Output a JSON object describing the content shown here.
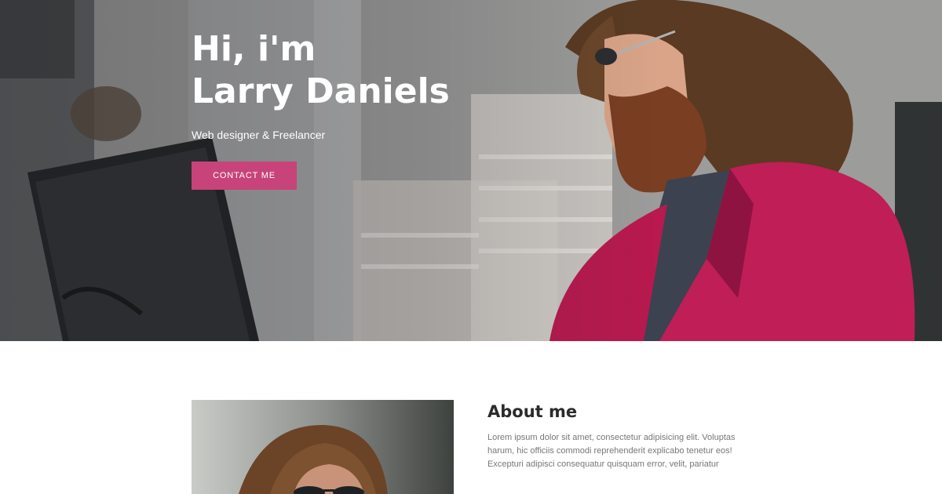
{
  "hero": {
    "title_line1": "Hi, i'm",
    "title_line2": "Larry Daniels",
    "subtitle": "Web designer & Freelancer",
    "cta_label": "CONTACT ME",
    "accent_color": "#c8437a",
    "background_image": "man-with-beard-pink-blazer-laptop"
  },
  "about": {
    "title": "About me",
    "text": "Lorem ipsum dolor sit amet, consectetur adipisicing elit. Voluptas harum, hic officiis commodi reprehenderit explicabo tenetur eos! Excepturi adipisci consequatur quisquam error, velit, pariatur",
    "photo": "portrait-man-sunglasses"
  }
}
